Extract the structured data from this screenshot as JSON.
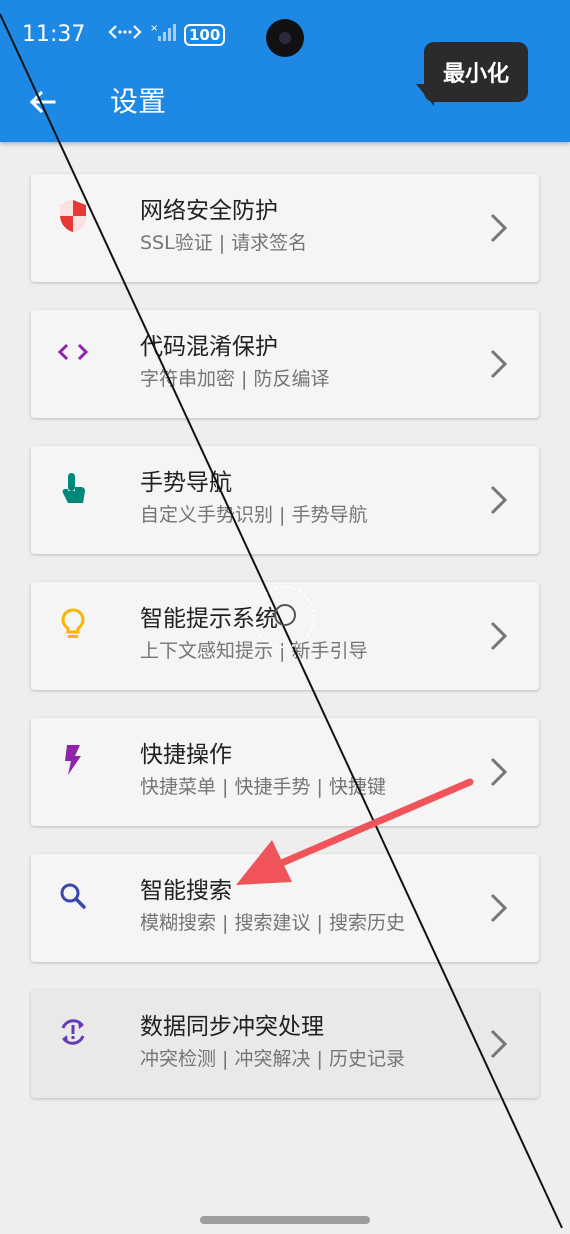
{
  "status_bar": {
    "time": "11:37",
    "battery": "100"
  },
  "app_bar": {
    "title": "设置",
    "minimize_label": "最小化"
  },
  "colors": {
    "app_bar": "#1e88e5",
    "annotation_arrow": "#f0545a"
  },
  "settings": [
    {
      "title": "网络安全防护",
      "subtitle": "SSL验证 | 请求签名",
      "icon": "shield-icon",
      "icon_color": "#e53935"
    },
    {
      "title": "代码混淆保护",
      "subtitle": "字符串加密 | 防反编译",
      "icon": "code-icon",
      "icon_color": "#8e24aa"
    },
    {
      "title": "手势导航",
      "subtitle": "自定义手势识别 | 手势导航",
      "icon": "touch-icon",
      "icon_color": "#00897b"
    },
    {
      "title": "智能提示系统",
      "subtitle": "上下文感知提示 | 新手引导",
      "icon": "lightbulb-icon",
      "icon_color": "#ffb300"
    },
    {
      "title": "快捷操作",
      "subtitle": "快捷菜单 | 快捷手势 | 快捷键",
      "icon": "lightning-icon",
      "icon_color": "#8e24aa"
    },
    {
      "title": "智能搜索",
      "subtitle": "模糊搜索 | 搜索建议 | 搜索历史",
      "icon": "search-icon",
      "icon_color": "#3949ab"
    },
    {
      "title": "数据同步冲突处理",
      "subtitle": "冲突检测 | 冲突解决 | 历史记录",
      "icon": "sync-alert-icon",
      "icon_color": "#673ab7"
    }
  ]
}
